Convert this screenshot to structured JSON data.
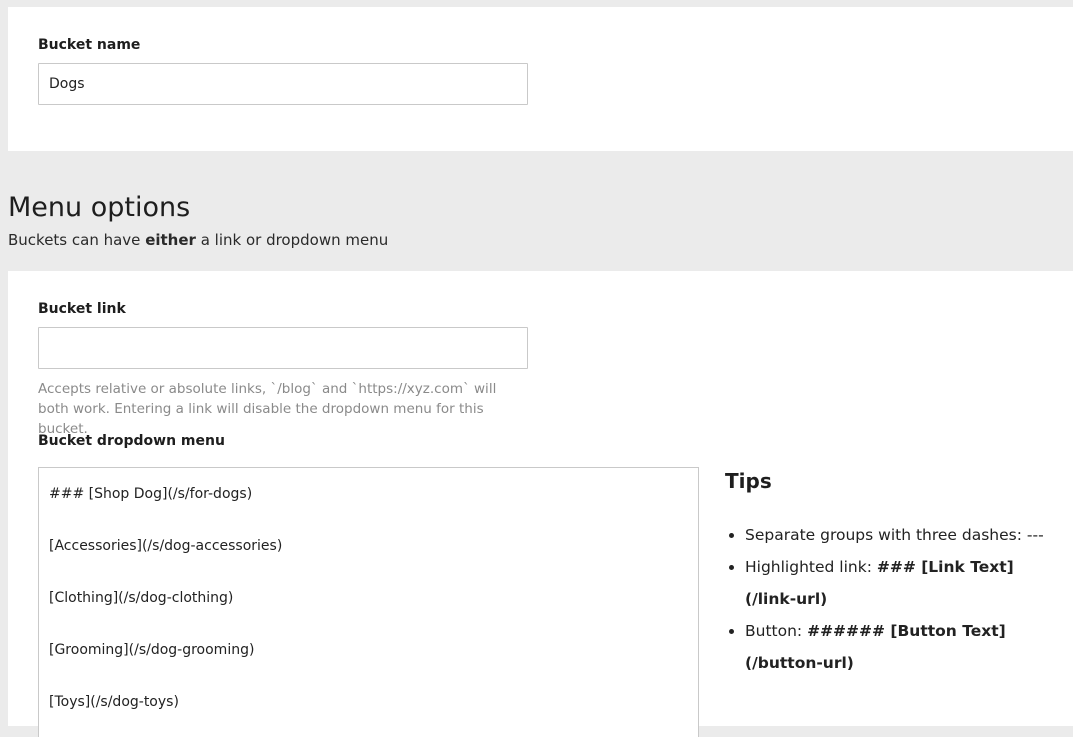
{
  "bucket_name": {
    "label": "Bucket name",
    "value": "Dogs"
  },
  "menu_options": {
    "title": "Menu options",
    "description_prefix": "Buckets can have ",
    "description_emphasis": "either",
    "description_suffix": " a link or dropdown menu"
  },
  "bucket_link": {
    "label": "Bucket link",
    "value": "",
    "help": "Accepts relative or absolute links, `/blog` and `https://xyz.com` will both work. Entering a link will disable the dropdown menu for this bucket."
  },
  "bucket_dropdown": {
    "label": "Bucket dropdown menu",
    "lines": [
      "### [Shop Dog](/s/for-dogs)",
      "",
      "[Accessories](/s/dog-accessories)",
      "",
      "[Clothing](/s/dog-clothing)",
      "",
      "[Grooming](/s/dog-grooming)",
      "",
      "[Toys](/s/dog-toys)"
    ]
  },
  "tips": {
    "title": "Tips",
    "items": [
      {
        "text": "Separate groups with three dashes: ---",
        "code": ""
      },
      {
        "text": "Highlighted link: ",
        "code": "### [Link Text](/link-url)"
      },
      {
        "text": "Button: ",
        "code": "###### [Button Text](/button-url)"
      }
    ]
  }
}
